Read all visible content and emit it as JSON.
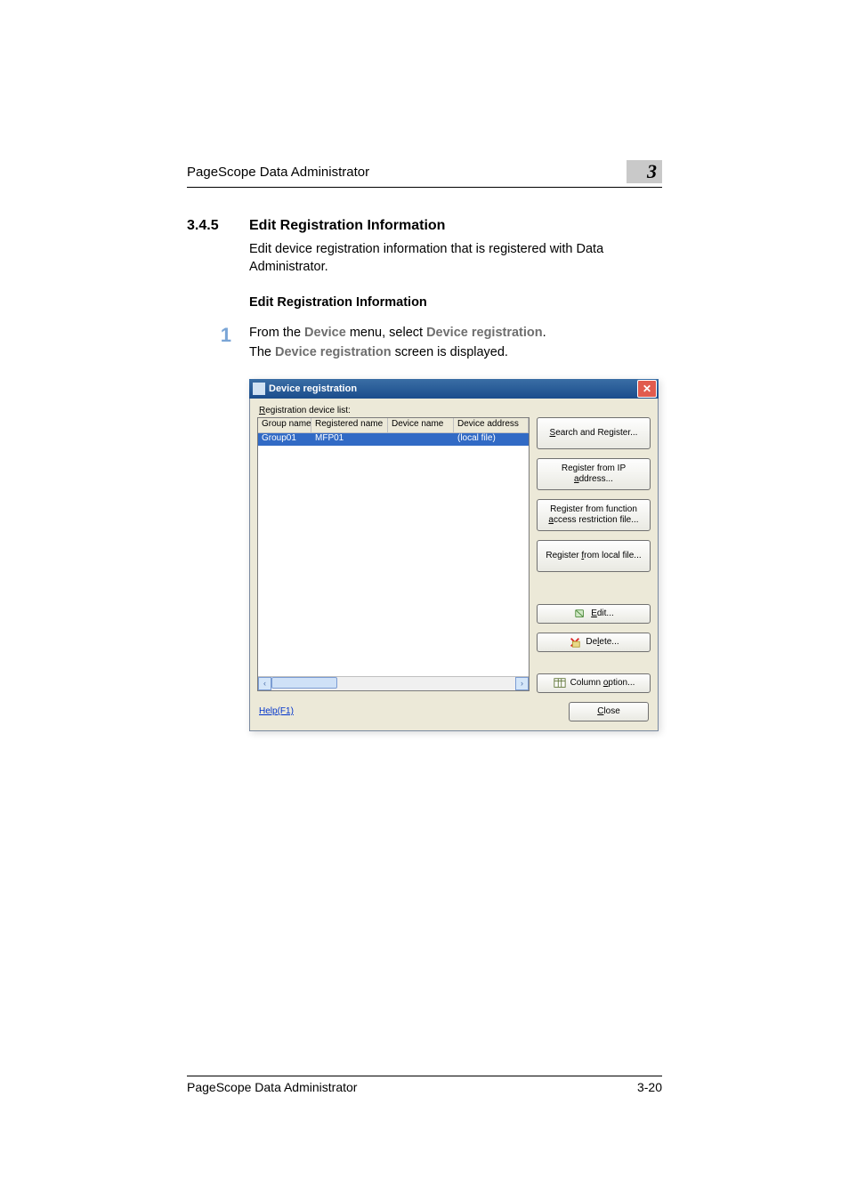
{
  "header": {
    "running_title": "PageScope Data Administrator",
    "chapter_number": "3"
  },
  "section": {
    "number": "3.4.5",
    "title": "Edit Registration Information",
    "intro": "Edit device registration information that is registered with Data Administrator.",
    "subhead": "Edit Registration Information"
  },
  "step": {
    "number": "1",
    "line1_pre": "From the ",
    "line1_menu1": "Device",
    "line1_mid": " menu, select ",
    "line1_menu2": "Device registration",
    "line1_post": ".",
    "line2_pre": "The ",
    "line2_menu": "Device registration",
    "line2_post": " screen is displayed."
  },
  "dialog": {
    "title": "Device registration",
    "list_label_pre": "R",
    "list_label_rest": "egistration device list:",
    "columns": {
      "group_name": "Group name",
      "registered_name": "Registered name",
      "device_name": "Device name",
      "device_address": "Device address"
    },
    "row": {
      "group_name": "Group01",
      "registered_name": "MFP01",
      "device_name": "",
      "device_address": "(local file)"
    },
    "buttons": {
      "search_register_pre": "S",
      "search_register_rest": "earch and Register...",
      "register_ip_line1": "Register from IP",
      "register_ip_line2_pre": "a",
      "register_ip_line2_rest": "ddress...",
      "register_func_line1": "Register from function",
      "register_func_line2_pre": "a",
      "register_func_line2_rest": "ccess restriction file...",
      "register_local_pre": "Register ",
      "register_local_ul": "f",
      "register_local_rest": "rom local file...",
      "edit_pre": "E",
      "edit_rest": "dit...",
      "delete_pre": "De",
      "delete_ul": "l",
      "delete_rest": "ete...",
      "column_option_pre": "Column ",
      "column_option_ul": "o",
      "column_option_rest": "ption..."
    },
    "help_link": "Help(F1)",
    "close_btn_pre": "C",
    "close_btn_rest": "lose"
  },
  "footer": {
    "running_title": "PageScope Data Administrator",
    "page_number": "3-20"
  }
}
